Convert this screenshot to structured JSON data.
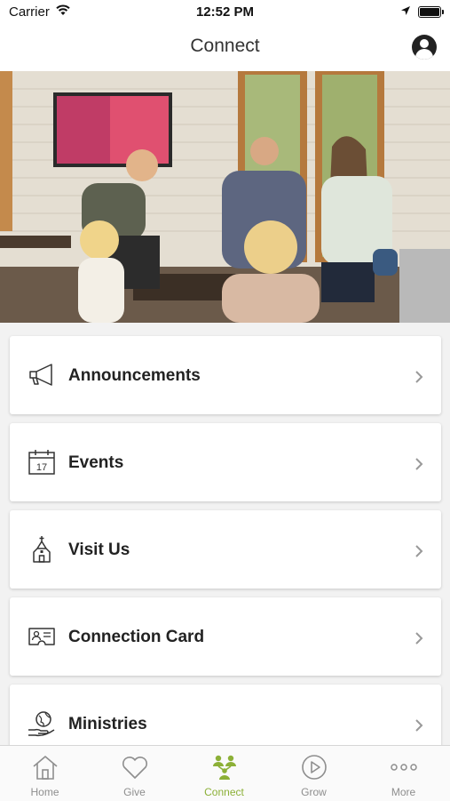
{
  "status_bar": {
    "carrier": "Carrier",
    "time": "12:52 PM"
  },
  "header": {
    "title": "Connect"
  },
  "menu": [
    {
      "label": "Announcements",
      "icon": "megaphone-icon"
    },
    {
      "label": "Events",
      "icon": "calendar-icon",
      "calendar_day": "17"
    },
    {
      "label": "Visit Us",
      "icon": "church-icon"
    },
    {
      "label": "Connection Card",
      "icon": "id-card-icon"
    },
    {
      "label": "Ministries",
      "icon": "globe-hand-icon"
    }
  ],
  "tabs": [
    {
      "label": "Home",
      "icon": "home-icon",
      "active": false
    },
    {
      "label": "Give",
      "icon": "heart-icon",
      "active": false
    },
    {
      "label": "Connect",
      "icon": "people-icon",
      "active": true
    },
    {
      "label": "Grow",
      "icon": "play-icon",
      "active": false
    },
    {
      "label": "More",
      "icon": "more-dots-icon",
      "active": false
    }
  ],
  "colors": {
    "accent": "#8cb037",
    "text": "#222222",
    "background": "#f2f2f2",
    "inactive_tab": "#8e8e8e"
  }
}
